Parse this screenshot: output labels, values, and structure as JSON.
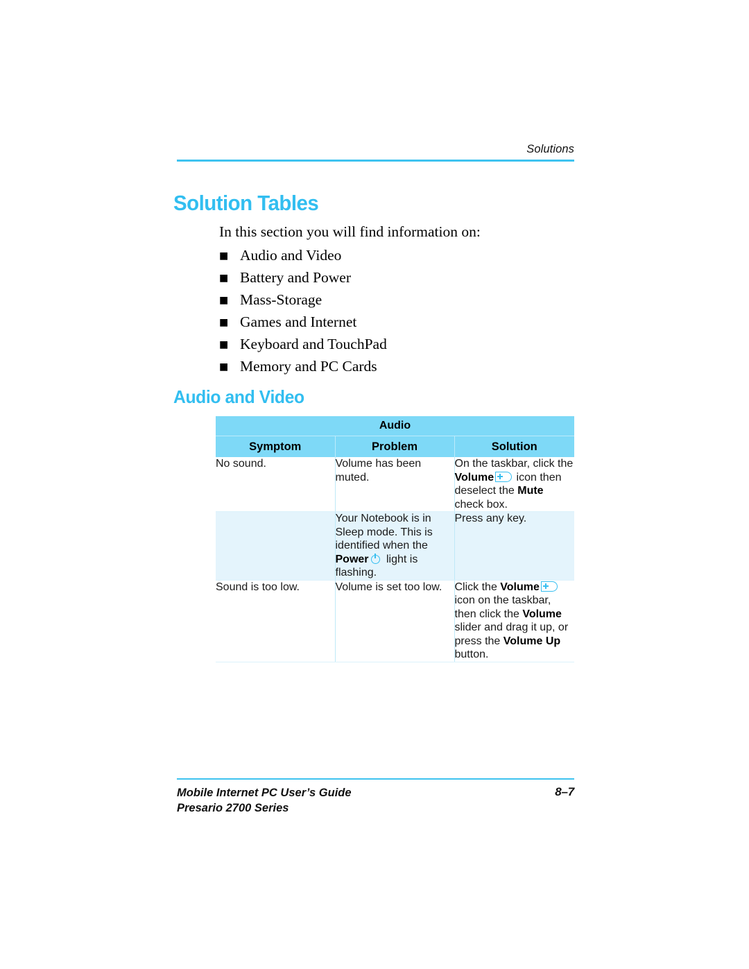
{
  "header": {
    "running_title": "Solutions"
  },
  "headings": {
    "h1": "Solution Tables",
    "h2": "Audio and Video"
  },
  "intro": {
    "text": "In this section you will find information on:",
    "bullet_glyph": "■",
    "items": [
      "Audio and Video",
      "Battery and Power",
      "Mass-Storage",
      "Games and Internet",
      "Keyboard and TouchPad",
      "Memory and PC Cards"
    ]
  },
  "table": {
    "group_header": "Audio",
    "columns": [
      "Symptom",
      "Problem",
      "Solution"
    ],
    "rows": [
      {
        "symptom": "No sound.",
        "problem": "Volume has been muted.",
        "solution_parts": [
          {
            "type": "text",
            "value": "On the taskbar, click the "
          },
          {
            "type": "bold",
            "value": "Volume"
          },
          {
            "type": "icon",
            "value": "volume-icon"
          },
          {
            "type": "text",
            "value": " icon then deselect the "
          },
          {
            "type": "bold",
            "value": "Mute"
          },
          {
            "type": "text",
            "value": " check box."
          }
        ]
      },
      {
        "symptom": "",
        "problem_parts": [
          {
            "type": "text",
            "value": "Your Notebook is in Sleep mode. This is identified when the "
          },
          {
            "type": "bold",
            "value": "Power"
          },
          {
            "type": "icon",
            "value": "power-icon"
          },
          {
            "type": "text",
            "value": " light is flashing."
          }
        ],
        "solution": "Press any key."
      },
      {
        "symptom": "Sound is too low.",
        "problem": "Volume is set too low.",
        "solution_parts": [
          {
            "type": "text",
            "value": "Click the "
          },
          {
            "type": "bold",
            "value": "Volume"
          },
          {
            "type": "icon",
            "value": "volume-icon"
          },
          {
            "type": "text",
            "value": " icon on the taskbar, then click the "
          },
          {
            "type": "bold",
            "value": "Volume"
          },
          {
            "type": "text",
            "value": " slider and drag it up, or press the "
          },
          {
            "type": "bold",
            "value": "Volume Up"
          },
          {
            "type": "text",
            "value": " button."
          }
        ]
      }
    ]
  },
  "footer": {
    "line1": "Mobile Internet PC User’s Guide",
    "line2": "Presario 2700 Series",
    "page": "8–7"
  },
  "colors": {
    "accent_cyan": "#32BEF0",
    "rule_cyan": "#3FC3F0",
    "table_header_bg": "#7ED9F7",
    "table_tint_row_bg": "#E4F4FC",
    "icon_cyan": "#36BEF0"
  }
}
